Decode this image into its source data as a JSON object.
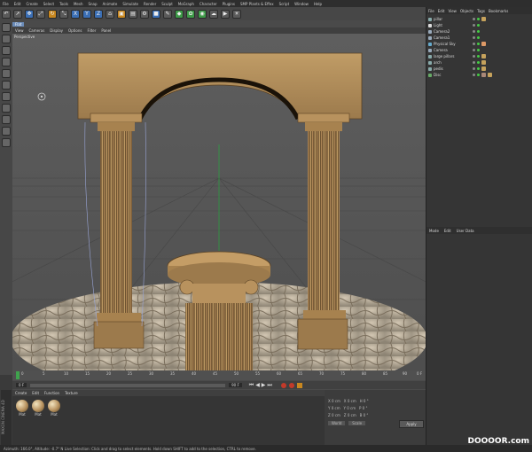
{
  "menubar": {
    "items": [
      "File",
      "Edit",
      "Create",
      "Select",
      "Tools",
      "Mesh",
      "Snap",
      "Animate",
      "Simulate",
      "Render",
      "Sculpt",
      "MoGraph",
      "Character",
      "Plugins",
      "SMP Plants & Effex",
      "Script",
      "Window",
      "Help"
    ]
  },
  "modebar": {
    "label": "Flat"
  },
  "viewport": {
    "menu": [
      "View",
      "Cameras",
      "Display",
      "Options",
      "Filter",
      "Panel"
    ],
    "label": "Perspective"
  },
  "timeline": {
    "ticks": [
      "0",
      "5",
      "10",
      "15",
      "20",
      "25",
      "30",
      "35",
      "40",
      "45",
      "50",
      "55",
      "60",
      "65",
      "70",
      "75",
      "80",
      "85",
      "90"
    ],
    "end_label": "0 F",
    "start_field": "0 F",
    "end_field": "90 F"
  },
  "materials": {
    "menu": [
      "Create",
      "Edit",
      "Function",
      "Texture"
    ],
    "items": [
      {
        "label": "Mat"
      },
      {
        "label": "Mat"
      },
      {
        "label": "Mat"
      }
    ]
  },
  "coordinates": {
    "rows": [
      {
        "a": "X",
        "av": "0 cm",
        "b": "X",
        "bv": "0 cm",
        "c": "H",
        "cv": "0 °"
      },
      {
        "a": "Y",
        "av": "0 cm",
        "b": "Y",
        "bv": "0 cm",
        "c": "P",
        "cv": "0 °"
      },
      {
        "a": "Z",
        "av": "0 cm",
        "b": "Z",
        "bv": "0 cm",
        "c": "B",
        "cv": "0 °"
      }
    ],
    "mode": "World",
    "scale_mode": "Scale",
    "apply": "Apply"
  },
  "object_manager": {
    "menu": [
      "File",
      "Edit",
      "View",
      "Objects",
      "Tags",
      "Bookmarks"
    ],
    "objects": [
      "pillar",
      "Light",
      "Camera2",
      "Camera1",
      "Physical Sky",
      "Camera",
      "large pillars",
      "arch",
      "pedis",
      "Disc"
    ]
  },
  "attributes": {
    "menu": [
      "Mode",
      "Edit",
      "User Data"
    ]
  },
  "status": {
    "text": "Azimuth: 166.0°, Altitude: -0.7°  N    Live Selection: Click and drag to select elements. Hold down SHIFT to add to the selection, CTRL to remove."
  },
  "watermark": "DOOOOR.com",
  "brand": "MAXON CINEMA 4D",
  "colors": {
    "stone": "#b0895a",
    "stone_dark": "#6a5030",
    "grid": "#444444",
    "sky": "#5a5a5a"
  }
}
